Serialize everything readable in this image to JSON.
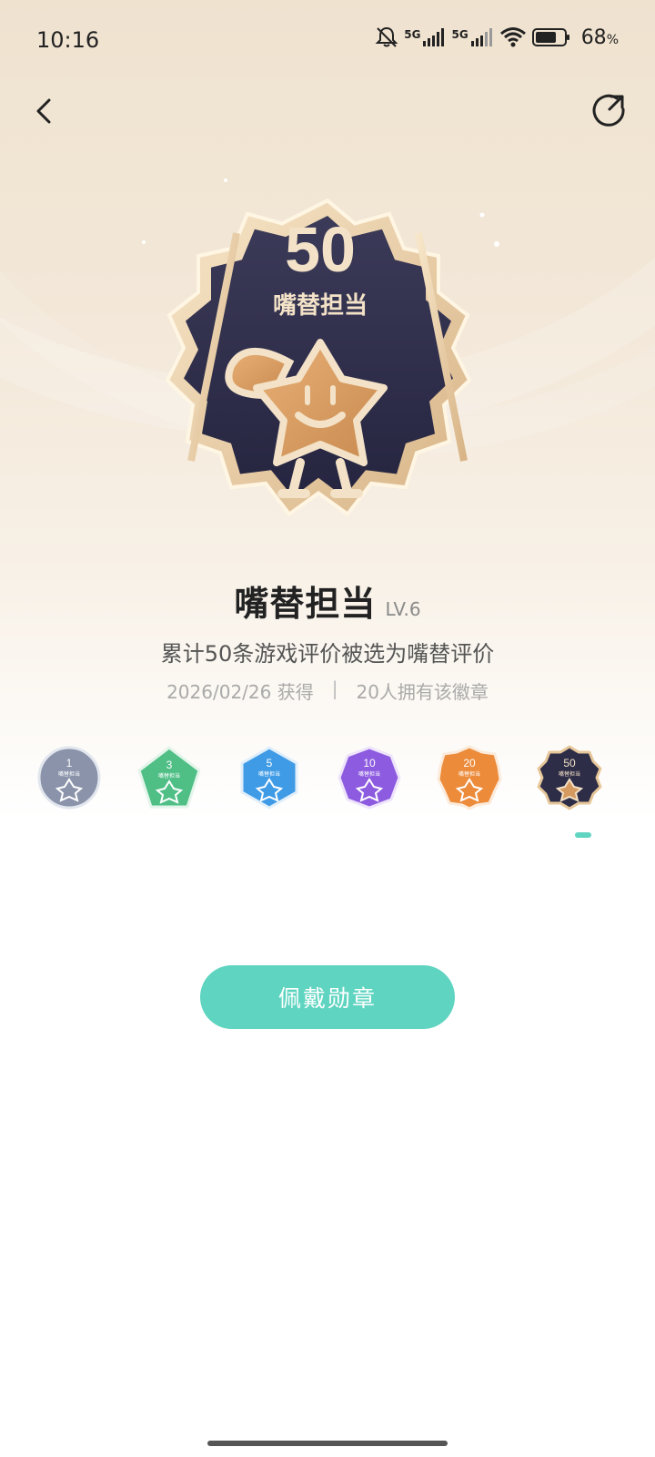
{
  "status": {
    "time": "10:16",
    "battery": "68",
    "battery_unit": "%",
    "net1": "5G",
    "net2": "5G"
  },
  "icons": {
    "back": "chevron-left-icon",
    "share": "share-icon",
    "silent": "bell-off-icon",
    "wifi": "wifi-icon",
    "battery": "battery-icon"
  },
  "badge": {
    "number": "50",
    "name": "嘴替担当",
    "level": "LV.6",
    "description": "累计50条游戏评价被选为嘴替评价",
    "obtained": "2026/02/26 获得",
    "owners": "20人拥有该徽章"
  },
  "levels": [
    {
      "number": "1",
      "label": "嘴替担当",
      "color": "#8a93aa"
    },
    {
      "number": "3",
      "label": "嘴替担当",
      "color": "#4fbf86"
    },
    {
      "number": "5",
      "label": "嘴替担当",
      "color": "#3f9be6"
    },
    {
      "number": "10",
      "label": "嘴替担当",
      "color": "#8d5be0"
    },
    {
      "number": "20",
      "label": "嘴替担当",
      "color": "#ec8b3a"
    },
    {
      "number": "50",
      "label": "嘴替担当",
      "color": "#2e2d47"
    }
  ],
  "selected_level_index": 5,
  "actions": {
    "wear_label": "佩戴勋章"
  },
  "colors": {
    "accent": "#5fd4c0",
    "badge_dark": "#2e2d47",
    "badge_gold": "#e6c79a"
  }
}
